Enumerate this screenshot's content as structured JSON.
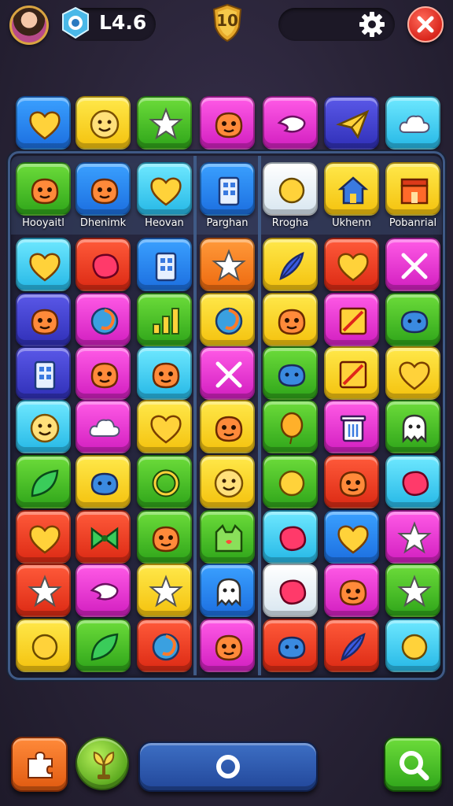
{
  "hud": {
    "level_label": "L4.6",
    "shield_value": "10"
  },
  "board": {
    "column_labels": [
      "Hooyaitl",
      "Dhenimk",
      "Heovan",
      "Parghan",
      "Rrogha",
      "Ukhenn",
      "Pobanrial"
    ]
  },
  "top_row": [
    {
      "color": "blue",
      "icon": "heart-icon"
    },
    {
      "color": "yellow",
      "icon": "smiley-face-icon"
    },
    {
      "color": "green",
      "icon": "star-icon"
    },
    {
      "color": "magenta",
      "icon": "monster-face-icon"
    },
    {
      "color": "magenta",
      "icon": "bird-icon"
    },
    {
      "color": "purple",
      "icon": "paper-plane-icon"
    },
    {
      "color": "cyan",
      "icon": "cloud-icon"
    }
  ],
  "header_row": [
    {
      "color": "green",
      "icon": "monster-face-icon"
    },
    {
      "color": "blue",
      "icon": "monster-face-icon"
    },
    {
      "color": "cyan",
      "icon": "heart-icon"
    },
    {
      "color": "blue",
      "icon": "building-icon"
    },
    {
      "color": "white",
      "icon": "circle-icon"
    },
    {
      "color": "yellow",
      "icon": "house-icon"
    },
    {
      "color": "yellow",
      "icon": "shop-icon"
    }
  ],
  "grid": [
    [
      {
        "color": "cyan",
        "icon": "heart-icon"
      },
      {
        "color": "red",
        "icon": "blob-icon"
      },
      {
        "color": "blue",
        "icon": "building-icon"
      },
      {
        "color": "orange",
        "icon": "star-icon"
      },
      {
        "color": "yellow",
        "icon": "feather-icon"
      },
      {
        "color": "red",
        "icon": "heart-icon"
      },
      {
        "color": "magenta",
        "icon": "cross-icon"
      }
    ],
    [
      {
        "color": "purple",
        "icon": "monster-face-icon"
      },
      {
        "color": "magenta",
        "icon": "swirl-icon"
      },
      {
        "color": "green",
        "icon": "bar-chart-icon"
      },
      {
        "color": "yellow",
        "icon": "swirl-icon"
      },
      {
        "color": "yellow",
        "icon": "monster-face-icon"
      },
      {
        "color": "magenta",
        "icon": "slash-box-icon"
      },
      {
        "color": "green",
        "icon": "blob-face-icon"
      }
    ],
    [
      {
        "color": "purple",
        "icon": "building-icon"
      },
      {
        "color": "magenta",
        "icon": "monster-face-icon"
      },
      {
        "color": "cyan",
        "icon": "monster-face-icon"
      },
      {
        "color": "magenta",
        "icon": "cross-icon"
      },
      {
        "color": "green",
        "icon": "blob-face-icon"
      },
      {
        "color": "yellow",
        "icon": "slash-box-icon"
      },
      {
        "color": "yellow",
        "icon": "heart-icon"
      }
    ],
    [
      {
        "color": "cyan",
        "icon": "smiley-face-icon"
      },
      {
        "color": "magenta",
        "icon": "cloud-icon"
      },
      {
        "color": "yellow",
        "icon": "heart-icon"
      },
      {
        "color": "yellow",
        "icon": "monster-face-icon"
      },
      {
        "color": "green",
        "icon": "balloon-icon"
      },
      {
        "color": "magenta",
        "icon": "trash-icon"
      },
      {
        "color": "green",
        "icon": "ghost-icon"
      }
    ],
    [
      {
        "color": "green",
        "icon": "leaf-icon"
      },
      {
        "color": "yellow",
        "icon": "blob-face-icon"
      },
      {
        "color": "green",
        "icon": "ring-icon"
      },
      {
        "color": "yellow",
        "icon": "smiley-face-icon"
      },
      {
        "color": "green",
        "icon": "circle-icon"
      },
      {
        "color": "red",
        "icon": "monster-face-icon"
      },
      {
        "color": "cyan",
        "icon": "blob-icon"
      }
    ],
    [
      {
        "color": "red",
        "icon": "heart-icon"
      },
      {
        "color": "red",
        "icon": "bow-icon"
      },
      {
        "color": "green",
        "icon": "monster-face-icon"
      },
      {
        "color": "green",
        "icon": "cat-face-icon"
      },
      {
        "color": "cyan",
        "icon": "blob-icon"
      },
      {
        "color": "blue",
        "icon": "heart-icon"
      },
      {
        "color": "magenta",
        "icon": "star-icon"
      }
    ],
    [
      {
        "color": "red",
        "icon": "star-icon"
      },
      {
        "color": "magenta",
        "icon": "bird-icon"
      },
      {
        "color": "yellow",
        "icon": "star-icon"
      },
      {
        "color": "blue",
        "icon": "ghost-icon"
      },
      {
        "color": "white",
        "icon": "blob-icon"
      },
      {
        "color": "magenta",
        "icon": "monster-face-icon"
      },
      {
        "color": "green",
        "icon": "star-icon"
      }
    ],
    [
      {
        "color": "yellow",
        "icon": "circle-icon"
      },
      {
        "color": "green",
        "icon": "leaf-icon"
      },
      {
        "color": "red",
        "icon": "swirl-icon"
      },
      {
        "color": "magenta",
        "icon": "monster-face-icon"
      },
      {
        "color": "red",
        "icon": "blob-face-icon"
      },
      {
        "color": "red",
        "icon": "feather-icon"
      },
      {
        "color": "cyan",
        "icon": "circle-icon"
      }
    ]
  ],
  "bottom_bar": {
    "left_icon": "puzzle-icon",
    "center_icon": "plant-icon",
    "main_icon": "circle-icon",
    "right_icon": "search-icon"
  }
}
